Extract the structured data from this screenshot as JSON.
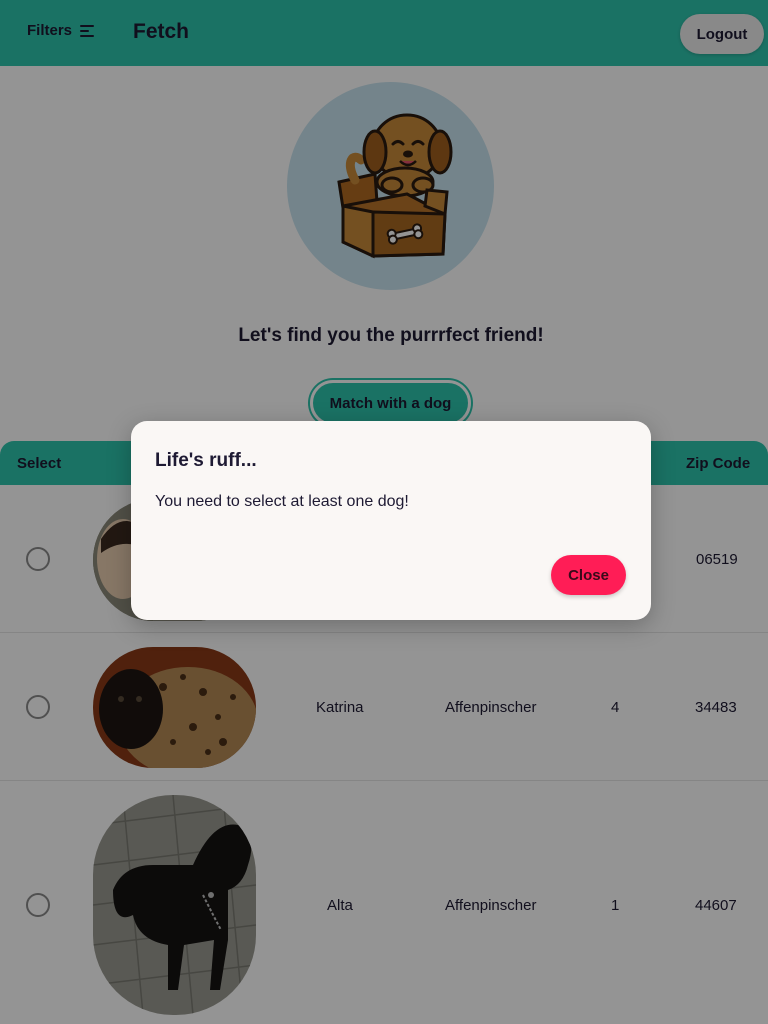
{
  "header": {
    "filters_label": "Filters",
    "brand": "Fetch",
    "logout_label": "Logout"
  },
  "hero": {
    "illustration": "dog-in-box-illustration",
    "tagline": "Let's find you the purrrfect friend!",
    "match_label": "Match with a dog"
  },
  "table": {
    "headers": {
      "select": "Select",
      "zip": "Zip Code"
    },
    "rows": [
      {
        "name": "",
        "breed": "",
        "age": "",
        "zip": "06519"
      },
      {
        "name": "Katrina",
        "breed": "Affenpinscher",
        "age": "4",
        "zip": "34483"
      },
      {
        "name": "Alta",
        "breed": "Affenpinscher",
        "age": "1",
        "zip": "44607"
      }
    ]
  },
  "dialog": {
    "title": "Life's ruff...",
    "message": "You need to select at least one dog!",
    "close_label": "Close"
  },
  "colors": {
    "accent": "#2ec4ad",
    "danger": "#ff1d56",
    "text": "#1e1a33",
    "hero_bg": "#c9e4ef"
  }
}
